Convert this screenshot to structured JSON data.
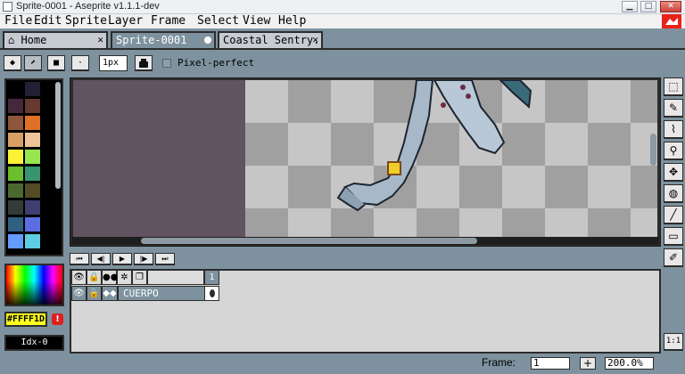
{
  "window": {
    "title": "Sprite-0001 - Aseprite v1.1.1-dev",
    "controls": [
      "minimize",
      "maximize",
      "close"
    ],
    "control_glyphs": [
      "▁",
      "□",
      "✕"
    ]
  },
  "menu": [
    {
      "label": "File"
    },
    {
      "label": "Edit"
    },
    {
      "label": "Sprite"
    },
    {
      "label": "Layer"
    },
    {
      "label": "Frame"
    },
    {
      "label": "Select"
    },
    {
      "label": "View"
    },
    {
      "label": "Help"
    }
  ],
  "tabs": [
    {
      "label": "⌂ Home",
      "close": "✕",
      "active": false
    },
    {
      "label": "Sprite-0001",
      "active": true
    },
    {
      "label": "Coastal Sentry.",
      "close": "✕",
      "active": false
    }
  ],
  "tool_options": {
    "buttons": [
      "◆",
      "⬈",
      "■",
      "·"
    ],
    "brush_size": "1px",
    "ink_icon": "ink-bottle-icon",
    "pixel_perfect_label": "Pixel-perfect"
  },
  "palette": {
    "colors": [
      "#000000",
      "#222034",
      "#45283c",
      "#663931",
      "#8f563b",
      "#df7126",
      "#d9a066",
      "#eec39a",
      "#fbf236",
      "#99e550",
      "#6abe30",
      "#37946e",
      "#4b692f",
      "#524b24",
      "#323c39",
      "#3f3f74",
      "#306082",
      "#5b6ee1",
      "#639bff",
      "#5fcde4"
    ]
  },
  "color": {
    "fg_hex": "#FFFF1D",
    "fg_value": "#ffff1d",
    "warning_glyph": "!",
    "index_label": "Idx-0"
  },
  "tools": [
    {
      "name": "marquee",
      "glyph": "⬚"
    },
    {
      "name": "pencil",
      "glyph": "✎"
    },
    {
      "name": "eyedropper",
      "glyph": "⌇"
    },
    {
      "name": "zoom",
      "glyph": "⚲"
    },
    {
      "name": "move",
      "glyph": "✥"
    },
    {
      "name": "fill",
      "glyph": "◍"
    },
    {
      "name": "line",
      "glyph": "╱"
    },
    {
      "name": "rectangle",
      "glyph": "▭"
    },
    {
      "name": "spray",
      "glyph": "✐"
    }
  ],
  "zoom_1to1_label": "1:1",
  "playback": [
    "⏮",
    "◀|",
    "▶",
    "|▶",
    "⏭"
  ],
  "timeline": {
    "header_icons": [
      "eye-icon",
      "lock-icon",
      "onion-icon",
      "gear-icon",
      "layers-icon"
    ],
    "header_glyphs": [
      "👁",
      "🔒",
      "●●",
      "✲",
      "❐"
    ],
    "frame_number": "1",
    "layer": {
      "name": "CUERPO",
      "icon_glyphs": [
        "👁",
        "🔒",
        "◆◆"
      ]
    }
  },
  "status": {
    "frame_label": "Frame:",
    "frame_value": "1",
    "add_frame": "+",
    "zoom": "200.0%"
  }
}
